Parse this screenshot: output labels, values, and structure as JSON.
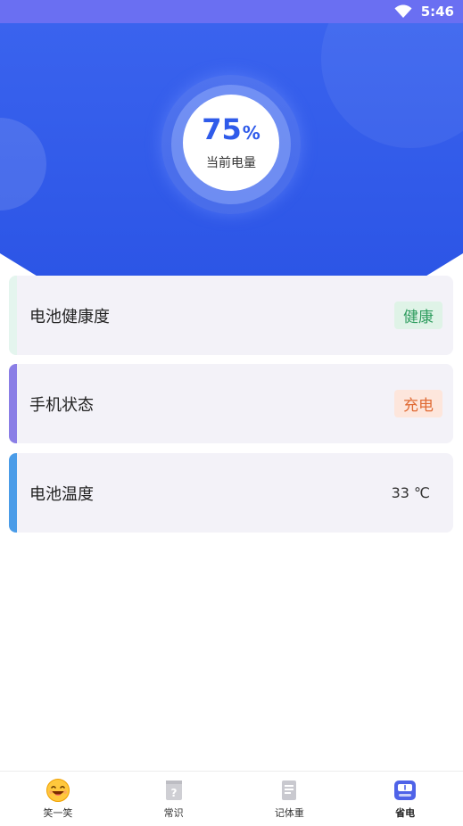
{
  "status_bar": {
    "time": "5:46"
  },
  "gauge": {
    "value": "75",
    "unit": "%",
    "label": "当前电量"
  },
  "cards": [
    {
      "label": "电池健康度",
      "value": "健康",
      "accent": "#e4f5ee",
      "tag_bg": "#dff3e7",
      "tag_fg": "#2f9d5f"
    },
    {
      "label": "手机状态",
      "value": "充电",
      "accent": "#8a7ee6",
      "tag_bg": "#fde6dc",
      "tag_fg": "#e06b35"
    },
    {
      "label": "电池温度",
      "value": "33 ℃",
      "accent": "#4a9ce8"
    }
  ],
  "nav": [
    {
      "label": "笑一笑",
      "icon": "smile-emoji-icon"
    },
    {
      "label": "常识",
      "icon": "question-book-icon"
    },
    {
      "label": "记体重",
      "icon": "notebook-icon"
    },
    {
      "label": "省电",
      "icon": "scale-icon",
      "active": true
    }
  ],
  "colors": {
    "hero_blue": "#2f5bea",
    "status_bar": "#6a6ff2"
  }
}
